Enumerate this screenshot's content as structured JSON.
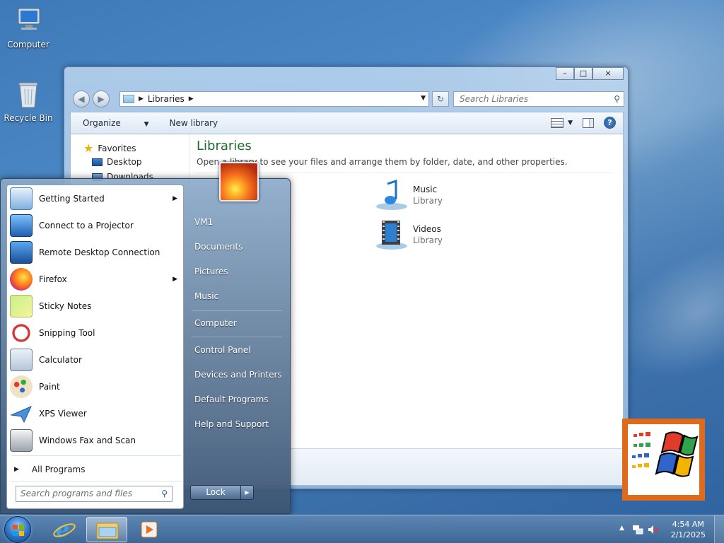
{
  "desktop": {
    "icons": [
      {
        "label": "Computer"
      },
      {
        "label": "Recycle Bin"
      }
    ]
  },
  "explorer": {
    "caption": {
      "minimize": "–",
      "maximize": "□",
      "close": "×"
    },
    "breadcrumb": [
      "Libraries"
    ],
    "search_placeholder": "Search Libraries",
    "toolbar": {
      "organize": "Organize",
      "new_library": "New library"
    },
    "nav": {
      "favorites": "Favorites",
      "items": [
        "Desktop",
        "Downloads"
      ]
    },
    "heading": "Libraries",
    "subheading": "Open a library to see your files and arrange them by folder, date, and other properties.",
    "libraries": [
      {
        "name": "Music",
        "type": "Library"
      },
      {
        "name": "Videos",
        "type": "Library"
      }
    ]
  },
  "start_menu": {
    "programs": [
      {
        "label": "Getting Started",
        "submenu": true,
        "icon": "getting-started-icon"
      },
      {
        "label": "Connect to a Projector",
        "submenu": false,
        "icon": "projector-icon"
      },
      {
        "label": "Remote Desktop Connection",
        "submenu": false,
        "icon": "remote-desktop-icon"
      },
      {
        "label": "Firefox",
        "submenu": true,
        "icon": "firefox-icon"
      },
      {
        "label": "Sticky Notes",
        "submenu": false,
        "icon": "sticky-notes-icon"
      },
      {
        "label": "Snipping Tool",
        "submenu": false,
        "icon": "snipping-tool-icon"
      },
      {
        "label": "Calculator",
        "submenu": false,
        "icon": "calculator-icon"
      },
      {
        "label": "Paint",
        "submenu": false,
        "icon": "paint-icon"
      },
      {
        "label": "XPS Viewer",
        "submenu": false,
        "icon": "xps-viewer-icon"
      },
      {
        "label": "Windows Fax and Scan",
        "submenu": false,
        "icon": "fax-scan-icon"
      }
    ],
    "all_programs": "All Programs",
    "search_placeholder": "Search programs and files",
    "right": {
      "user": "VM1",
      "documents": "Documents",
      "pictures": "Pictures",
      "music": "Music",
      "computer": "Computer",
      "control_panel": "Control Panel",
      "devices": "Devices and Printers",
      "default_programs": "Default Programs",
      "help": "Help and Support"
    },
    "lock": "Lock"
  },
  "taskbar": {
    "time": "4:54 AM",
    "date": "2/1/2025"
  }
}
